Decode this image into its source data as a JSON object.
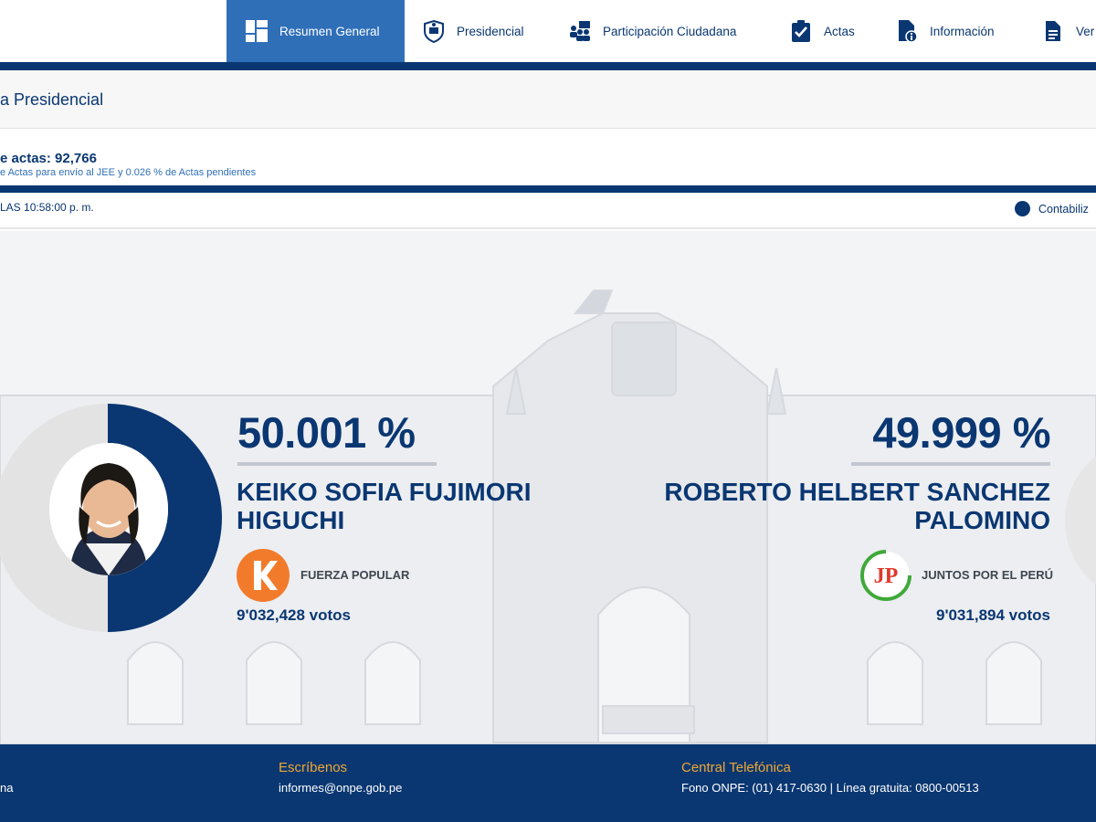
{
  "nav": {
    "items": [
      {
        "label": "Resumen General",
        "icon": "dashboard-icon"
      },
      {
        "label": "Presidencial",
        "icon": "shield-icon"
      },
      {
        "label": "Participación Ciudadana",
        "icon": "people-icon"
      },
      {
        "label": "Actas",
        "icon": "clipboard-check-icon"
      },
      {
        "label": "Información",
        "icon": "document-info-icon"
      },
      {
        "label": "Ver",
        "icon": "document-icon"
      }
    ]
  },
  "page": {
    "title": "a Presidencial"
  },
  "actas": {
    "main": "e actas: 92,766",
    "sub": "e Actas para envío al JEE y 0.026 % de Actas pendientes"
  },
  "update": {
    "text": "LAS 10:58:00 p. m.",
    "legend": "Contabiliz"
  },
  "candidates": [
    {
      "percent": "50.001 %",
      "name_line1": "KEIKO SOFIA FUJIMORI",
      "name_line2": "HIGUCHI",
      "party": "FUERZA POPULAR",
      "votes": "9'032,428 votos",
      "share": 50.001,
      "logo_text": "K",
      "color": "#f27b2b"
    },
    {
      "percent": "49.999 %",
      "name_line1": "ROBERTO HELBERT SANCHEZ",
      "name_line2": "PALOMINO",
      "party": "JUNTOS POR EL PERÚ",
      "votes": "9'031,894 votos",
      "share": 49.999,
      "logo_text": "JP",
      "color": "#e0392a"
    }
  ],
  "footer": {
    "col1": "na",
    "col2_title": "Escríbenos",
    "col2_text": "informes@onpe.gob.pe",
    "col3_title": "Central Telefónica",
    "col3_text": "Fono ONPE: (01) 417-0630 | Línea gratuita: 0800-00513"
  },
  "colors": {
    "primary": "#0a3772",
    "active_nav": "#2f6fb8",
    "accent_orange": "#f0a733",
    "fuerza_popular": "#f27b2b",
    "juntos_green": "#3fa93a"
  }
}
